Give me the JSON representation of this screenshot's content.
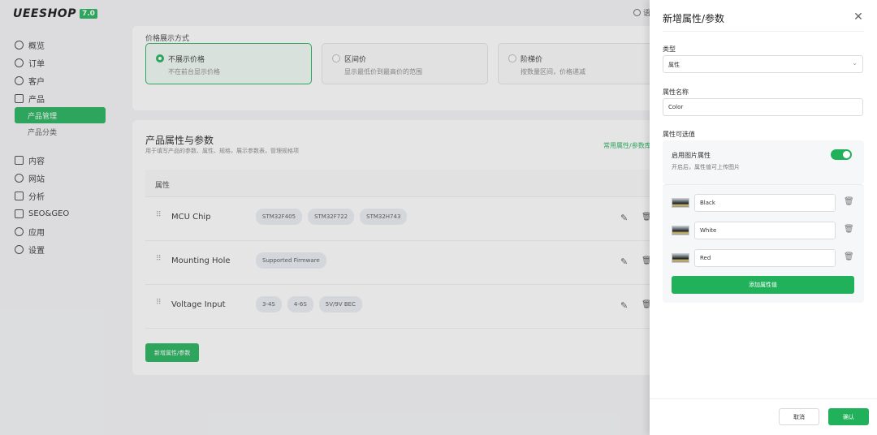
{
  "brand": {
    "logo_text": "UEESHOP",
    "version": "7.0",
    "accent": "#20b15a"
  },
  "topbar": {
    "right_text": "语"
  },
  "sidebar": {
    "items": [
      {
        "label": "概览",
        "icon": "clock-icon"
      },
      {
        "label": "订单",
        "icon": "minus-circle-icon"
      },
      {
        "label": "客户",
        "icon": "user-icon"
      },
      {
        "label": "产品",
        "icon": "cube-icon"
      }
    ],
    "sub_items": [
      {
        "label": "产品管理",
        "active": true
      },
      {
        "label": "产品分类",
        "active": false
      }
    ],
    "items2": [
      {
        "label": "内容",
        "icon": "document-icon"
      },
      {
        "label": "网站",
        "icon": "globe-icon"
      },
      {
        "label": "分析",
        "icon": "chart-icon"
      },
      {
        "label": "SEO&GEO",
        "icon": "seo-icon"
      },
      {
        "label": "应用",
        "icon": "link-icon"
      },
      {
        "label": "设置",
        "icon": "gear-icon"
      }
    ]
  },
  "price_section": {
    "label": "价格展示方式",
    "options": [
      {
        "title": "不展示价格",
        "desc": "不在前台显示价格",
        "selected": true
      },
      {
        "title": "区间价",
        "desc": "显示最低价到最高价的范围",
        "selected": false
      },
      {
        "title": "阶梯价",
        "desc": "按数量区间，价格递减",
        "selected": false
      }
    ]
  },
  "attributes": {
    "title": "产品属性与参数",
    "desc": "用于填写产品的参数、属性、规格，展示参数表，管理规格项",
    "link": "常用属性/参数库",
    "header": "属性",
    "rows": [
      {
        "name": "MCU Chip",
        "tags": [
          "STM32F405",
          "STM32F722",
          "STM32H743"
        ]
      },
      {
        "name": "Mounting Hole",
        "tags": [
          "Supported Firmware"
        ]
      },
      {
        "name": "Voltage Input",
        "tags": [
          "3-4S",
          "4-6S",
          "5V/9V BEC"
        ]
      }
    ],
    "add_button": "新增属性/参数"
  },
  "drawer": {
    "title": "新增属性/参数",
    "type_label": "类型",
    "type_value": "属性",
    "name_label": "属性名称",
    "name_value": "Color",
    "values_label": "属性可选值",
    "image_toggle": {
      "title": "启用图片属性",
      "desc": "开启后，属性值可上传图片",
      "enabled": true
    },
    "values": [
      "Black",
      "White",
      "Red"
    ],
    "add_value_button": "添加属性值",
    "cancel": "取消",
    "confirm": "确认"
  }
}
